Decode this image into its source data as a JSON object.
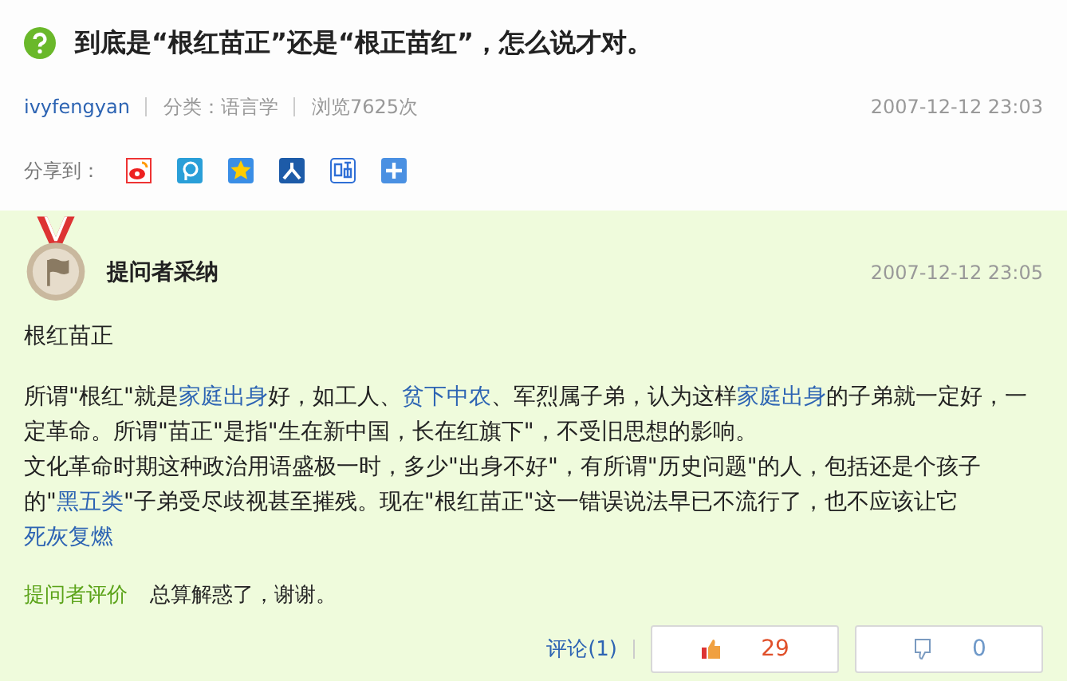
{
  "question": {
    "title": "到底是“根红苗正”还是“根正苗红”，怎么说才对。",
    "author": "ivyfengyan",
    "category": "分类：语言学",
    "views": "浏览7625次",
    "date": "2007-12-12 23:03"
  },
  "share": {
    "label": "分享到：",
    "icons": [
      {
        "kind": "weibo"
      },
      {
        "kind": "pengyou"
      },
      {
        "kind": "qzone"
      },
      {
        "kind": "renren"
      },
      {
        "kind": "tieba"
      },
      {
        "kind": "more"
      }
    ]
  },
  "answer": {
    "badge": "提问者采纳",
    "date": "2007-12-12 23:05",
    "summary": "根红苗正",
    "paragraphs": [
      [
        {
          "text": "所谓\"根红\"就是",
          "link": false
        },
        {
          "text": "家庭出身",
          "link": true
        },
        {
          "text": "好，如工人、",
          "link": false
        },
        {
          "text": "贫下中农",
          "link": true
        },
        {
          "text": "、军烈属子弟，认为这样",
          "link": false
        },
        {
          "text": "家庭出身",
          "link": true
        },
        {
          "text": "的子弟就一定好，一定革命。所谓\"苗正\"是指\"生在新中国，长在红旗下\"，不受旧思想的影响。",
          "link": false
        }
      ],
      [
        {
          "text": "文化革命时期这种政治用语盛极一时，多少\"出身不好\"，有所谓\"历史问题\"的人，包括还是个孩子的\"",
          "link": false
        },
        {
          "text": "黑五类",
          "link": true
        },
        {
          "text": "\"子弟受尽歧视甚至摧残。现在\"根红苗正\"这一错误说法早已不流行了，也不应该让它",
          "link": false
        },
        {
          "text": "死灰复燃",
          "link": true
        }
      ]
    ],
    "rating_label": "提问者评价",
    "rating_text": "总算解惑了，谢谢。",
    "comment_link": "评论(1)",
    "votes": [
      {
        "kind": "up",
        "count": "29"
      },
      {
        "kind": "down",
        "count": "0"
      }
    ]
  }
}
